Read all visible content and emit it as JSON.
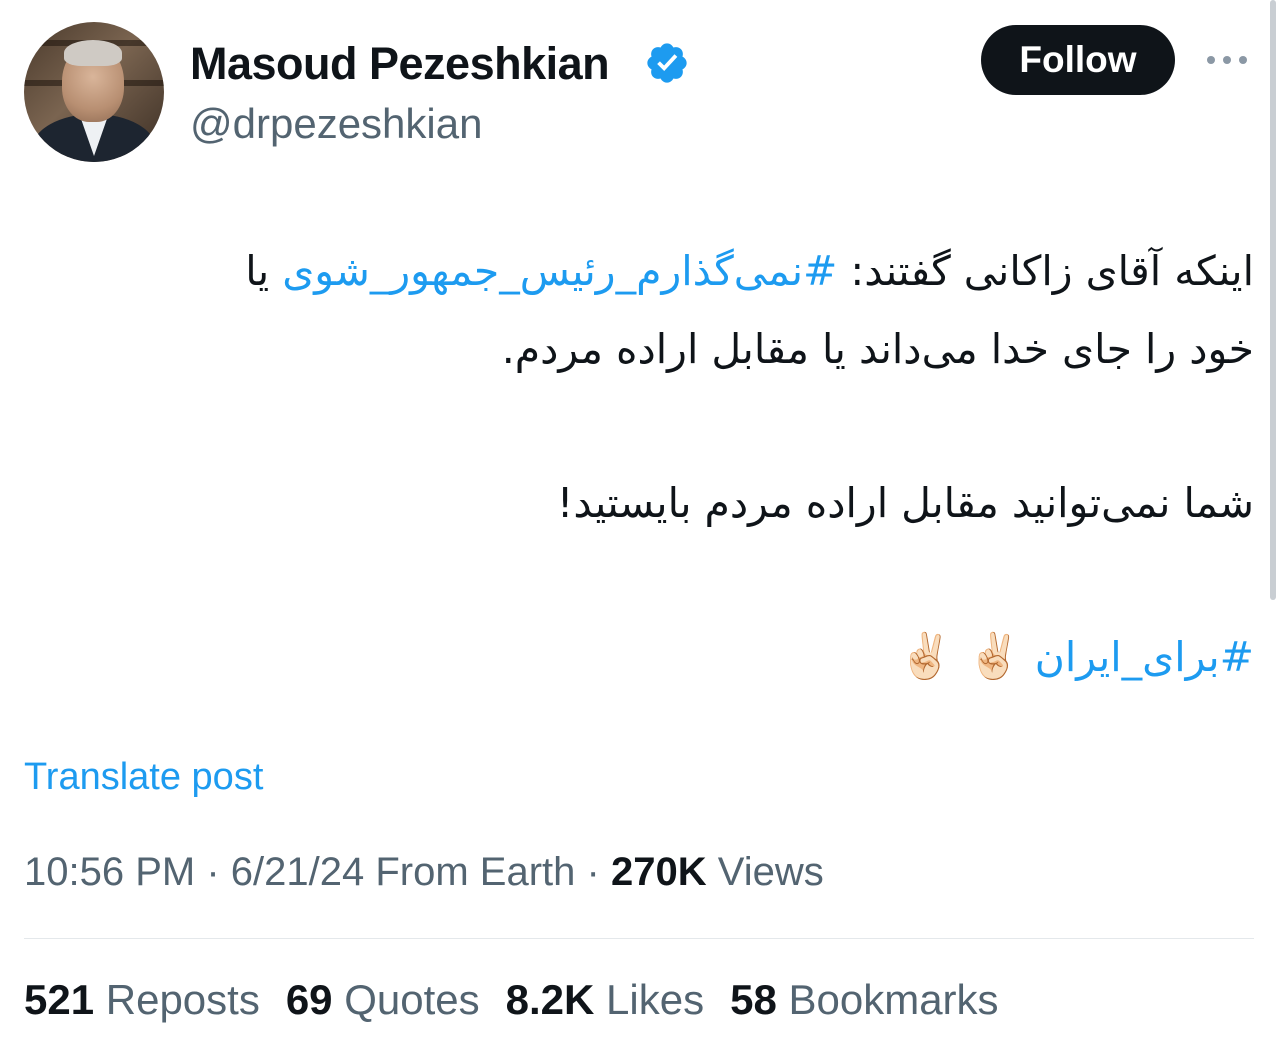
{
  "author": {
    "name": "Masoud Pezeshkian",
    "handle": "@drpezeshkian",
    "verified": true
  },
  "follow_label": "Follow",
  "tweet": {
    "line1_start": "اینکه آقای زاکانی گفتند: ",
    "hashtag1": "#نمی‌گذارم_رئیس_جمهور_شوی",
    "line1_end": " یا",
    "line2": "خود را جای خدا می‌داند یا مقابل اراده مردم.",
    "line3": "شما نمی‌توانید مقابل اراده مردم بایستید!",
    "hashtag2": "#برای_ایران",
    "emojis": "✌🏻 ✌🏻"
  },
  "translate_label": "Translate post",
  "meta": {
    "time": "10:56 PM",
    "date": "6/21/24",
    "location": "From Earth",
    "views_count": "270K",
    "views_label": "Views"
  },
  "stats": {
    "reposts_count": "521",
    "reposts_label": "Reposts",
    "quotes_count": "69",
    "quotes_label": "Quotes",
    "likes_count": "8.2K",
    "likes_label": "Likes",
    "bookmarks_count": "58",
    "bookmarks_label": "Bookmarks"
  },
  "colors": {
    "accent": "#1d9bf0",
    "text_primary": "#0f1419",
    "text_secondary": "#536471",
    "button_bg": "#0f1419"
  },
  "icons": {
    "verified": "verified-badge-icon",
    "more": "more-options-icon"
  }
}
